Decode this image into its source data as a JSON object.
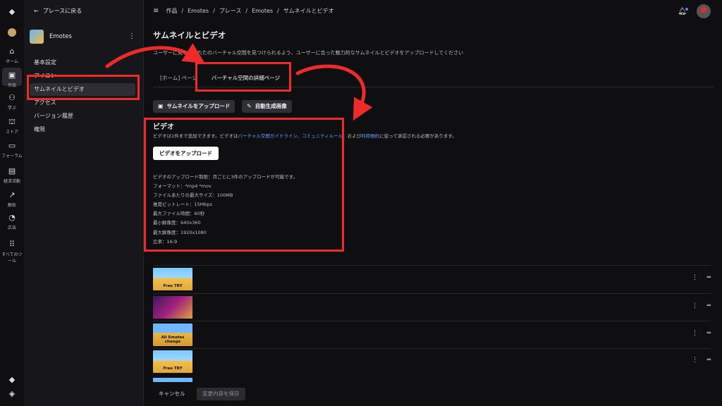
{
  "rail": {
    "items": [
      {
        "icon": "roblox-logo-icon",
        "label": ""
      },
      {
        "icon": "avatar-icon",
        "label": ""
      },
      {
        "icon": "home-icon",
        "label": "ホーム"
      },
      {
        "icon": "creations-icon",
        "label": "作品"
      },
      {
        "icon": "learn-icon",
        "label": "学ぶ"
      },
      {
        "icon": "store-icon",
        "label": "ストア"
      },
      {
        "icon": "forum-icon",
        "label": "フォーラム"
      },
      {
        "icon": "wallet-icon",
        "label": "経済活動"
      },
      {
        "icon": "analytics-icon",
        "label": "解析"
      },
      {
        "icon": "ads-icon",
        "label": "広告"
      },
      {
        "icon": "grid-icon",
        "label": "すべてのツール"
      }
    ]
  },
  "sidebar": {
    "back_label": "プレースに戻る",
    "game_name": "Emotes",
    "game_thumb_text": "Free TRY",
    "items": [
      {
        "label": "基本設定"
      },
      {
        "label": "アイコン"
      },
      {
        "label": "サムネイルとビデオ"
      },
      {
        "label": "アクセス"
      },
      {
        "label": "バージョン履歴"
      },
      {
        "label": "権限"
      }
    ]
  },
  "breadcrumb": [
    "作品",
    "Emotes",
    "プレース",
    "Emotes",
    "サムネイルとビデオ"
  ],
  "page": {
    "title": "サムネイルとビデオ",
    "description": "ユーザーに見つけられたのバーチャル空間を見つけられるよう、ユーザーに合った魅力的なサムネイルとビデオをアップロードしてください"
  },
  "tabs": [
    {
      "label": "[ホーム] ページ",
      "active": false
    },
    {
      "label": "バーチャル空間の詳細ページ",
      "active": true
    }
  ],
  "actions": {
    "upload_thumbnail": "サムネイルをアップロード",
    "auto_generate": "自動生成画像"
  },
  "video": {
    "title": "ビデオ",
    "desc_prefix": "ビデオは1件まで追加できます。ビデオは",
    "link1": "バーチャル空間ガイドライン",
    "sep": "、",
    "link2": "コミュニティルール",
    "desc_mid": "、および",
    "link3": "利用規約",
    "desc_suffix": "に従って承認される必要があります。",
    "upload_button": "ビデオをアップロード",
    "specs": [
      "ビデオのアップロード制限：月ごとに3件のアップロードが可能です。",
      "フォーマット：*mp4 *mov",
      "ファイルあたりの最大サイズ：100MB",
      "推奨ビットレート：15Mbps",
      "最大ファイル時間：60秒",
      "最小解像度：640x360",
      "最大解像度：1920x1080",
      "比率：16:9"
    ]
  },
  "thumbnails": [
    {
      "caption": "Free TRY",
      "style": "yellow"
    },
    {
      "caption": "",
      "style": "purple"
    },
    {
      "caption": "All Emotes change",
      "style": "mix"
    },
    {
      "caption": "Free TRY",
      "style": "yellow"
    }
  ],
  "footer": {
    "cancel": "キャンセル",
    "save": "変更内容を保存"
  },
  "colors": {
    "annotation": "#ee2b2b",
    "link": "#6a9cff",
    "background": "#0f0f12"
  }
}
